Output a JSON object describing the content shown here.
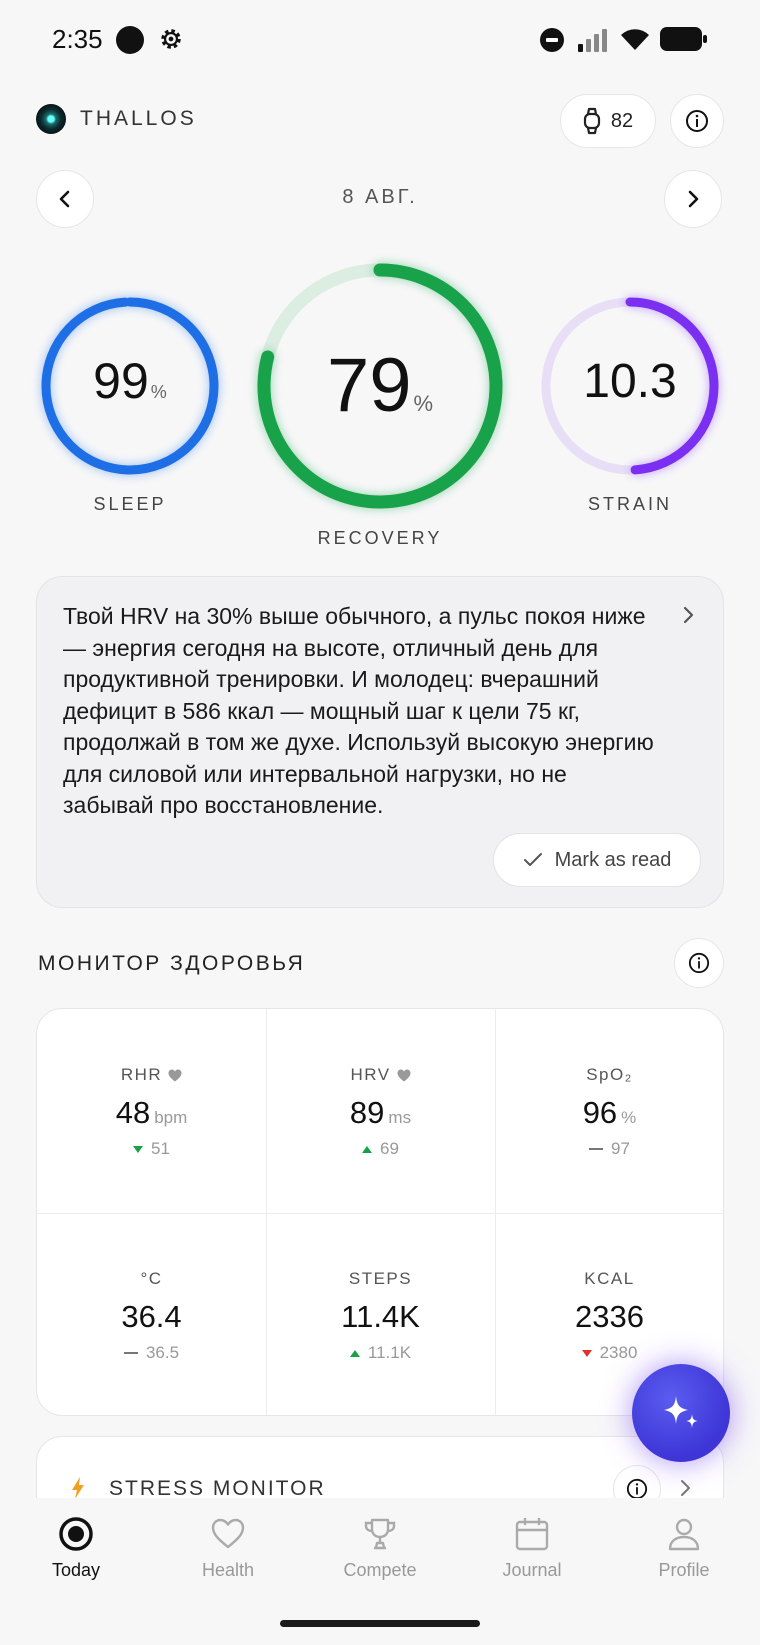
{
  "status_bar": {
    "time": "2:35"
  },
  "header": {
    "brand": "THALLOS",
    "device_battery": "82",
    "date": "8 АВГ."
  },
  "rings": {
    "sleep": {
      "value": "99",
      "unit": "%",
      "label": "SLEEP",
      "fraction": 0.99,
      "color": "#1e6fe6"
    },
    "recovery": {
      "value": "79",
      "unit": "%",
      "label": "RECOVERY",
      "fraction": 0.79,
      "color": "#18a34a"
    },
    "strain": {
      "value": "10.3",
      "unit": "",
      "label": "STRAIN",
      "fraction": 0.49,
      "color": "#7b2ff0"
    }
  },
  "insight": {
    "text": "Твой HRV на 30% выше обычного, а пульс покоя ниже — энергия сегодня на высоте, отличный день для продуктивной тренировки. И молодец: вчерашний дефицит в 586 ккал — мощный шаг к цели 75 кг, продолжай в том же духе. Используй высокую энергию для силовой или интервальной нагрузки, но не забывай про восстановление.",
    "mark_read": "Mark as read"
  },
  "health_monitor": {
    "title": "МОНИТОР ЗДОРОВЬЯ",
    "metrics": [
      {
        "label": "RHR",
        "value": "48",
        "unit": "bpm",
        "baseline": "51",
        "trend": "down-good",
        "heart": true
      },
      {
        "label": "HRV",
        "value": "89",
        "unit": "ms",
        "baseline": "69",
        "trend": "up-good",
        "heart": true
      },
      {
        "label": "SpO₂",
        "value": "96",
        "unit": "%",
        "baseline": "97",
        "trend": "flat",
        "heart": false
      },
      {
        "label": "°C",
        "value": "36.4",
        "unit": "",
        "baseline": "36.5",
        "trend": "flat",
        "heart": false
      },
      {
        "label": "STEPS",
        "value": "11.4K",
        "unit": "",
        "baseline": "11.1K",
        "trend": "up-good",
        "heart": false
      },
      {
        "label": "KCAL",
        "value": "2336",
        "unit": "",
        "baseline": "2380",
        "trend": "down-bad",
        "heart": false
      }
    ]
  },
  "stress_monitor": {
    "title": "STRESS MONITOR"
  },
  "bottom_nav": [
    {
      "label": "Today",
      "icon": "today-icon",
      "active": true
    },
    {
      "label": "Health",
      "icon": "heart-icon",
      "active": false
    },
    {
      "label": "Compete",
      "icon": "trophy-icon",
      "active": false
    },
    {
      "label": "Journal",
      "icon": "calendar-icon",
      "active": false
    },
    {
      "label": "Profile",
      "icon": "person-icon",
      "active": false
    }
  ]
}
